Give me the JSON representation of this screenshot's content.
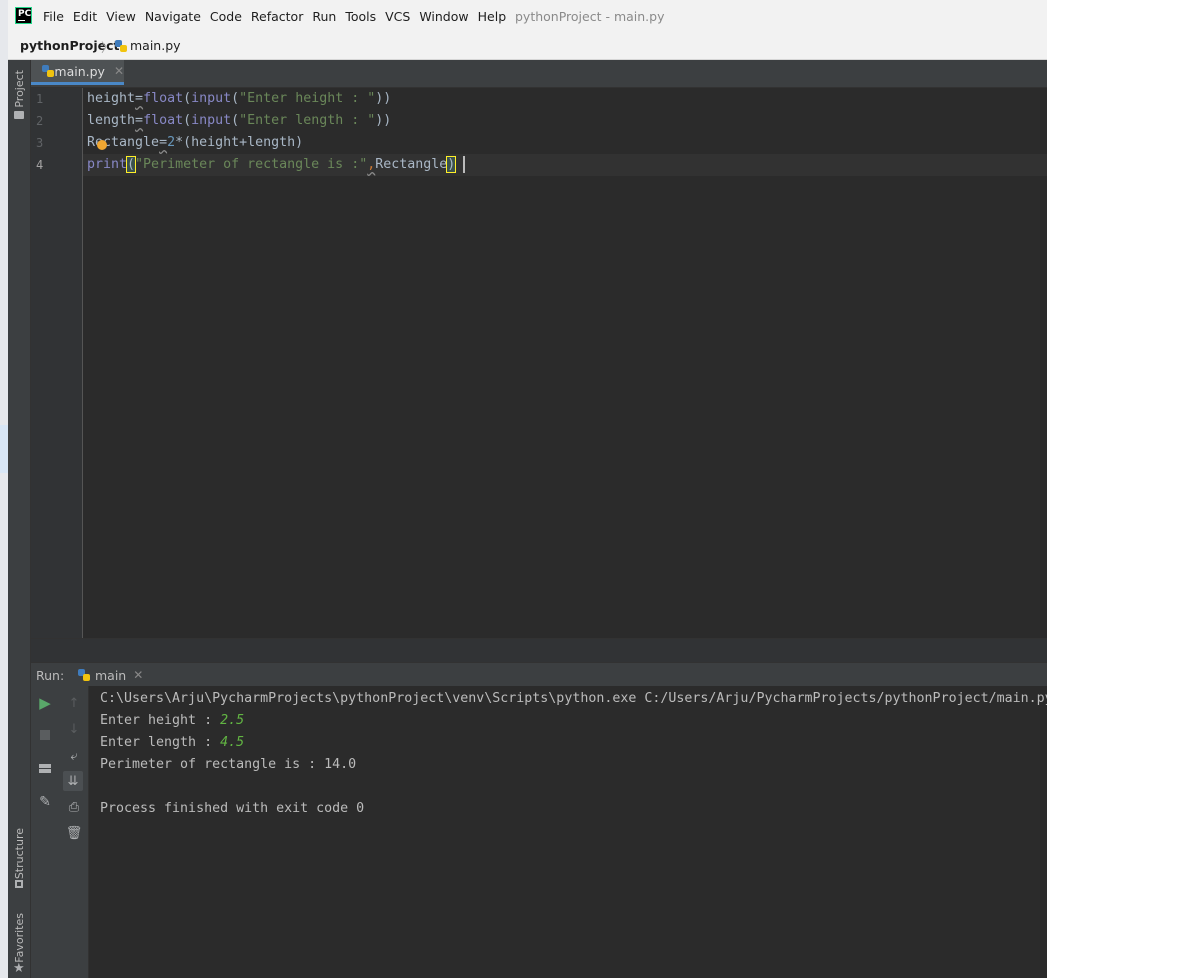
{
  "window_title": "pythonProject - main.py",
  "logo_text": "PC",
  "menu": [
    "File",
    "Edit",
    "View",
    "Navigate",
    "Code",
    "Refactor",
    "Run",
    "Tools",
    "VCS",
    "Window",
    "Help"
  ],
  "breadcrumb": {
    "project": "pythonProject",
    "separator": "〉",
    "file": "main.py"
  },
  "tool_windows": {
    "project": "Project",
    "structure": "Structure",
    "favorites": "Favorites"
  },
  "editor": {
    "tab": {
      "label": "main.py",
      "close": "✕"
    },
    "line_numbers": [
      "1",
      "2",
      "3",
      "4"
    ],
    "lines": [
      {
        "a": "height",
        "b": "=",
        "c": "float",
        "d": "(",
        "e": "input",
        "f": "(",
        "g": "\"Enter height : \"",
        "h": "))"
      },
      {
        "a": "length",
        "b": "=",
        "c": "float",
        "d": "(",
        "e": "input",
        "f": "(",
        "g": "\"Enter length : \"",
        "h": "))"
      },
      {
        "a": "Rectangle",
        "b": "=",
        "c": "2",
        "d": "*(height+length)"
      },
      {
        "a": "print",
        "b": "(",
        "c": "\"Perimeter of rectangle is :\"",
        "d": ",",
        "e": "Rectangle",
        "f": ")"
      }
    ]
  },
  "run_panel": {
    "label": "Run:",
    "tab": "main",
    "close": "✕",
    "output": {
      "line1": "C:\\Users\\Arju\\PycharmProjects\\pythonProject\\venv\\Scripts\\python.exe C:/Users/Arju/PycharmProjects/pythonProject/main.py",
      "prompt_height": "Enter height : ",
      "input_height": "2.5",
      "prompt_length": "Enter length : ",
      "input_length": "4.5",
      "result": "Perimeter of rectangle is : 14.0",
      "exit": "Process finished with exit code 0"
    }
  },
  "colors": {
    "accent": "#4a88c7",
    "run_green": "#62b543",
    "bulb": "#f0a732"
  }
}
